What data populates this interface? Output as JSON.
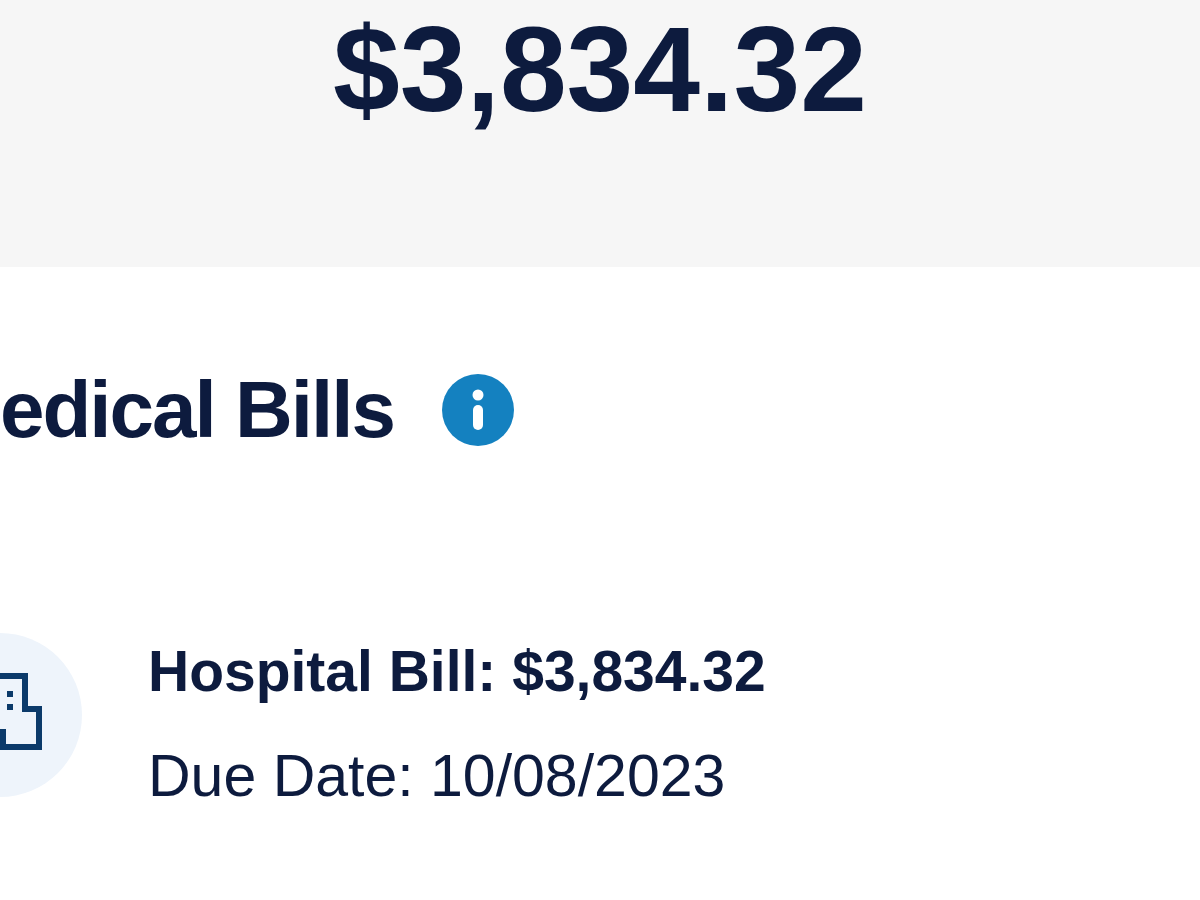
{
  "balance": {
    "amount": "$3,834.32"
  },
  "section": {
    "title": "edical Bills"
  },
  "bills": [
    {
      "kind": "hospital",
      "title": "Hospital Bill: $3,834.32",
      "due": "Due Date: 10/08/2023"
    }
  ]
}
